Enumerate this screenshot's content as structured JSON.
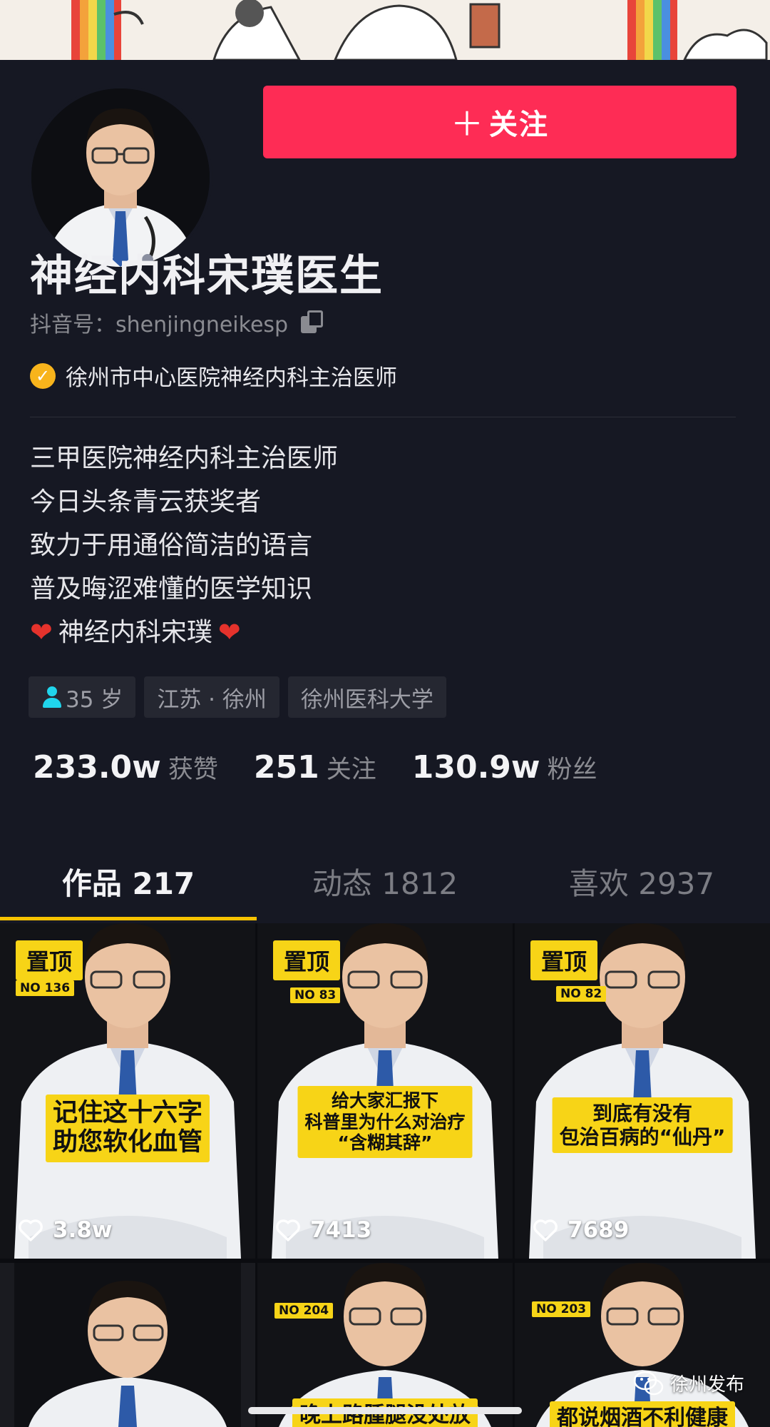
{
  "profile": {
    "name": "神经内科宋璞医生",
    "douyin_id": "抖音号：shenjingneikesp",
    "verification": "徐州市中心医院神经内科主治医师",
    "follow_button": "关注",
    "bio": [
      "三甲医院神经内科主治医师",
      "今日头条青云获奖者",
      "致力于用通俗简洁的语言",
      "普及晦涩难懂的医学知识"
    ],
    "bio_last": "神经内科宋璞",
    "tags": {
      "age": "35 岁",
      "location": "江苏 · 徐州",
      "school": "徐州医科大学"
    },
    "stats": [
      {
        "num": "233.0w",
        "label": "获赞"
      },
      {
        "num": "251",
        "label": "关注"
      },
      {
        "num": "130.9w",
        "label": "粉丝"
      }
    ]
  },
  "tabs": [
    {
      "label": "作品 217",
      "active": true
    },
    {
      "label": "动态 1812",
      "active": false
    },
    {
      "label": "喜欢 2937",
      "active": false
    }
  ],
  "videos": [
    {
      "pin": "置顶",
      "no": "NO 136",
      "caption": [
        "记住这十六字",
        "助您软化血管"
      ],
      "likes": "3.8w"
    },
    {
      "pin": "置顶",
      "no": "NO 83",
      "caption": [
        "给大家汇报下",
        "科普里为什么对治疗",
        "“含糊其辞”"
      ],
      "likes": "7413"
    },
    {
      "pin": "置顶",
      "no": "NO 82",
      "caption": [
        "到底有没有",
        "包治百病的“仙丹”"
      ],
      "likes": "7689"
    },
    {
      "no": "",
      "caption": []
    },
    {
      "no": "NO 204",
      "caption": [
        "晚上路腫腿没处放"
      ]
    },
    {
      "no": "NO 203",
      "caption": [
        "都说烟酒不利健康"
      ]
    }
  ],
  "watermark": "徐州发布",
  "colors": {
    "follow": "#fe2c55",
    "accent": "#f8c200",
    "background": "#161823",
    "caption_bg": "#f7d417"
  }
}
